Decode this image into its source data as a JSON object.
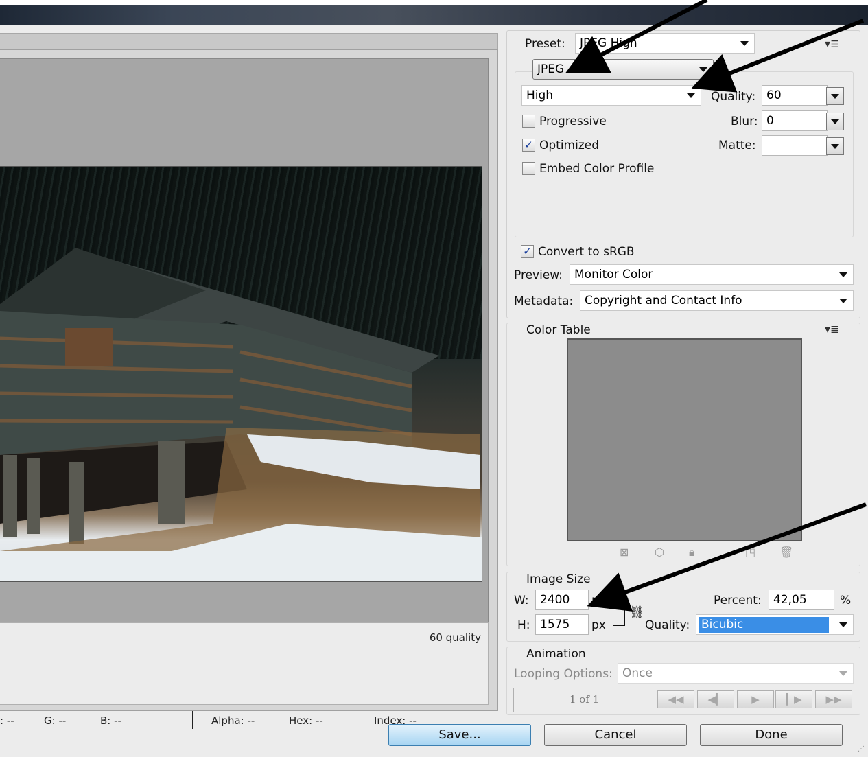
{
  "preset": {
    "label": "Preset:",
    "value": "JPEG High"
  },
  "format": {
    "value": "JPEG"
  },
  "compression": {
    "value": "High"
  },
  "quality": {
    "label": "Quality:",
    "value": "60"
  },
  "blur": {
    "label": "Blur:",
    "value": "0"
  },
  "matte": {
    "label": "Matte:",
    "value": ""
  },
  "options": {
    "progressive": {
      "label": "Progressive",
      "checked": false
    },
    "optimized": {
      "label": "Optimized",
      "checked": true
    },
    "embed_profile": {
      "label": "Embed Color Profile",
      "checked": false
    },
    "convert_srgb": {
      "label": "Convert to sRGB",
      "checked": true
    }
  },
  "preview_setting": {
    "label": "Preview:",
    "value": "Monitor Color"
  },
  "metadata": {
    "label": "Metadata:",
    "value": "Copyright and Contact Info"
  },
  "color_table": {
    "title": "Color Table"
  },
  "image_size": {
    "title": "Image Size",
    "w_label": "W:",
    "w_value": "2400",
    "w_unit": "px",
    "h_label": "H:",
    "h_value": "1575",
    "h_unit": "px",
    "percent_label": "Percent:",
    "percent_value": "42,05",
    "percent_unit": "%",
    "quality_label": "Quality:",
    "quality_value": "Bicubic"
  },
  "animation": {
    "title": "Animation",
    "looping_label": "Looping Options:",
    "looping_value": "Once",
    "frame_counter": "1 of 1"
  },
  "preview_pane": {
    "quality_note": "60 quality"
  },
  "status": {
    "r": ": --",
    "g": "G: --",
    "b": "B: --",
    "alpha": "Alpha: --",
    "hex": "Hex: --",
    "index": "Index: --"
  },
  "buttons": {
    "save": "Save...",
    "cancel": "Cancel",
    "done": "Done"
  },
  "icons": {
    "menu": "panel-menu-icon",
    "link": "chain-link-icon",
    "nav": [
      "first-frame-icon",
      "previous-frame-icon",
      "play-icon",
      "next-frame-icon",
      "last-frame-icon"
    ]
  }
}
